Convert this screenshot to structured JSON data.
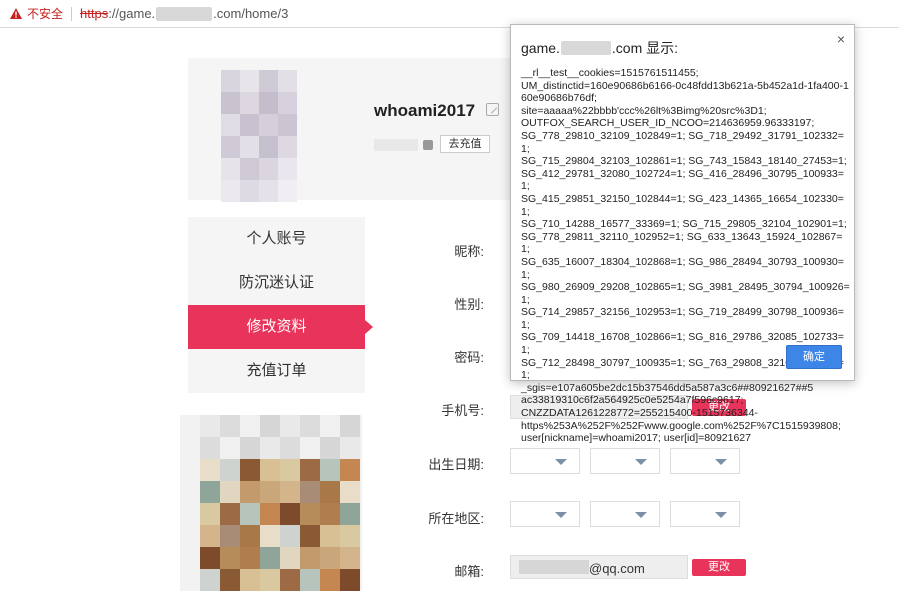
{
  "browser": {
    "security_label": "不安全",
    "url_scheme": "https",
    "url_prefix": "://game.",
    "url_suffix": ".com/home/3"
  },
  "profile": {
    "username": "whoami2017",
    "recharge_label": "去充值"
  },
  "menu": {
    "items": [
      {
        "label": "个人账号"
      },
      {
        "label": "防沉迷认证"
      },
      {
        "label": "修改资料"
      },
      {
        "label": "充值订单"
      }
    ],
    "active_index": 2,
    "accent_color": "#e8345a"
  },
  "form": {
    "nickname_label": "昵称:",
    "gender_label": "性别:",
    "password_label": "密码:",
    "phone_label": "手机号:",
    "birth_label": "出生日期:",
    "region_label": "所在地区:",
    "email_label": "邮箱:",
    "change_label": "更改",
    "email_visible_suffix": "@qq.com"
  },
  "dialog": {
    "title_prefix": "game.",
    "title_suffix": ".com 显示:",
    "close_icon": "×",
    "message": "__rl__test__cookies=1515761511455;\nUM_distinctid=160e90686b6166-0c48fdd13b621a-5b452a1d-1fa400-160e90686b76df;\nsite=aaaaa%22bbbb'ccc%26lt%3Bimg%20src%3D1;\nOUTFOX_SEARCH_USER_ID_NCOO=214636959.96333197;\nSG_778_29810_32109_102849=1; SG_718_29492_31791_102332=1;\nSG_715_29804_32103_102861=1; SG_743_15843_18140_27453=1;\nSG_412_29781_32080_102724=1; SG_416_28496_30795_100933=1;\nSG_415_29851_32150_102844=1; SG_423_14365_16654_102330=1;\nSG_710_14288_16577_33369=1; SG_715_29805_32104_102901=1;\nSG_778_29811_32110_102952=1; SG_633_13643_15924_102867=1;\nSG_635_16007_18304_102868=1; SG_986_28494_30793_100930=1;\nSG_980_26909_29208_102865=1; SG_3981_28495_30794_100926=1;\nSG_714_29857_32156_102953=1; SG_719_28499_30798_100936=1;\nSG_709_14418_16708_102866=1; SG_816_29786_32085_102733=1;\nSG_712_28498_30797_100935=1; SG_763_29808_32107_102900=1;\n_sgis=e107a605be2dc15b37546dd5a587a3c6##80921627##5\nac33819310c6f2a564925c0e5254a7f596c9617;\nCNZZDATA1261228772=255215400-1515736344-\nhttps%253A%252F%252Fwww.google.com%252F%7C1515939808;\nuser[nickname]=whoami2017; user[id]=80921627",
    "ok_label": "确定"
  }
}
